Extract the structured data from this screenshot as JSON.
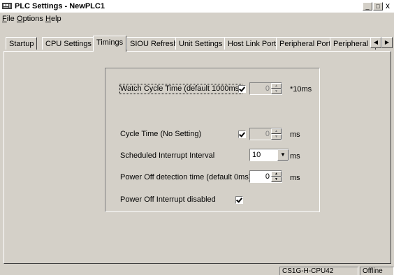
{
  "window": {
    "title": "PLC Settings - NewPLC1",
    "minimize": "_",
    "restore": "□",
    "close": "x"
  },
  "menubar": [
    {
      "first": "F",
      "rest": "ile"
    },
    {
      "first": "O",
      "rest": "ptions"
    },
    {
      "first": "H",
      "rest": "elp"
    }
  ],
  "tabs": [
    "Startup",
    "CPU Settings",
    "Timings",
    "SIOU Refresh",
    "Unit Settings",
    "Host Link Port",
    "Peripheral Port",
    "Peripheral S"
  ],
  "active_tab": "Timings",
  "timings": {
    "watch_cycle_label": "Watch Cycle Time (default 1000ms)",
    "watch_cycle_checked": true,
    "watch_cycle_value": "0",
    "watch_cycle_unit": "*10ms",
    "cycle_time_label": "Cycle Time (No Setting)",
    "cycle_time_checked": true,
    "cycle_time_value": "0",
    "cycle_time_unit": "ms",
    "sched_interrupt_label": "Scheduled Interrupt Interval",
    "sched_interrupt_value": "10",
    "sched_interrupt_unit": "ms",
    "power_off_label": "Power Off detection time (default 0ms)",
    "power_off_value": "0",
    "power_off_unit": "ms",
    "power_off_interrupt_label": "Power Off Interrupt disabled",
    "power_off_interrupt_checked": true
  },
  "statusbar": {
    "cpu": "CS1G-H-CPU42",
    "state": "Offline"
  }
}
